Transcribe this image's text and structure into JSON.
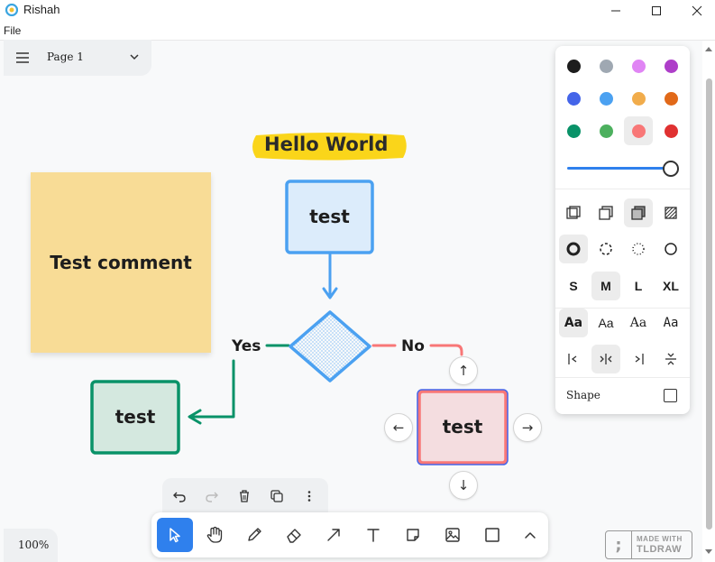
{
  "window": {
    "title": "Rishah"
  },
  "menu": {
    "file": "File"
  },
  "page_menu": {
    "current_page": "Page 1"
  },
  "canvas": {
    "title_text": "Hello World",
    "sticky_text": "Test comment",
    "node_top": "test",
    "node_left": "test",
    "node_right": "test",
    "label_yes": "Yes",
    "label_no": "No"
  },
  "style_panel": {
    "colors": [
      "#1d1d1d",
      "#9fa8b2",
      "#e085f4",
      "#ae3ec9",
      "#4465e9",
      "#4ba1f1",
      "#f1ac4b",
      "#e16919",
      "#099268",
      "#4cb05e",
      "#f87777",
      "#e03131"
    ],
    "selected_color": "#f87777",
    "opacity_percent": 100,
    "sizes": [
      "S",
      "M",
      "L",
      "XL"
    ],
    "selected_size": "M",
    "fonts": [
      "Aa",
      "Aa",
      "Aa",
      "Aa"
    ],
    "shape_label": "Shape"
  },
  "zoom": {
    "level": "100%"
  },
  "badge": {
    "line1": "MADE WITH",
    "line2": "TLDRAW"
  }
}
